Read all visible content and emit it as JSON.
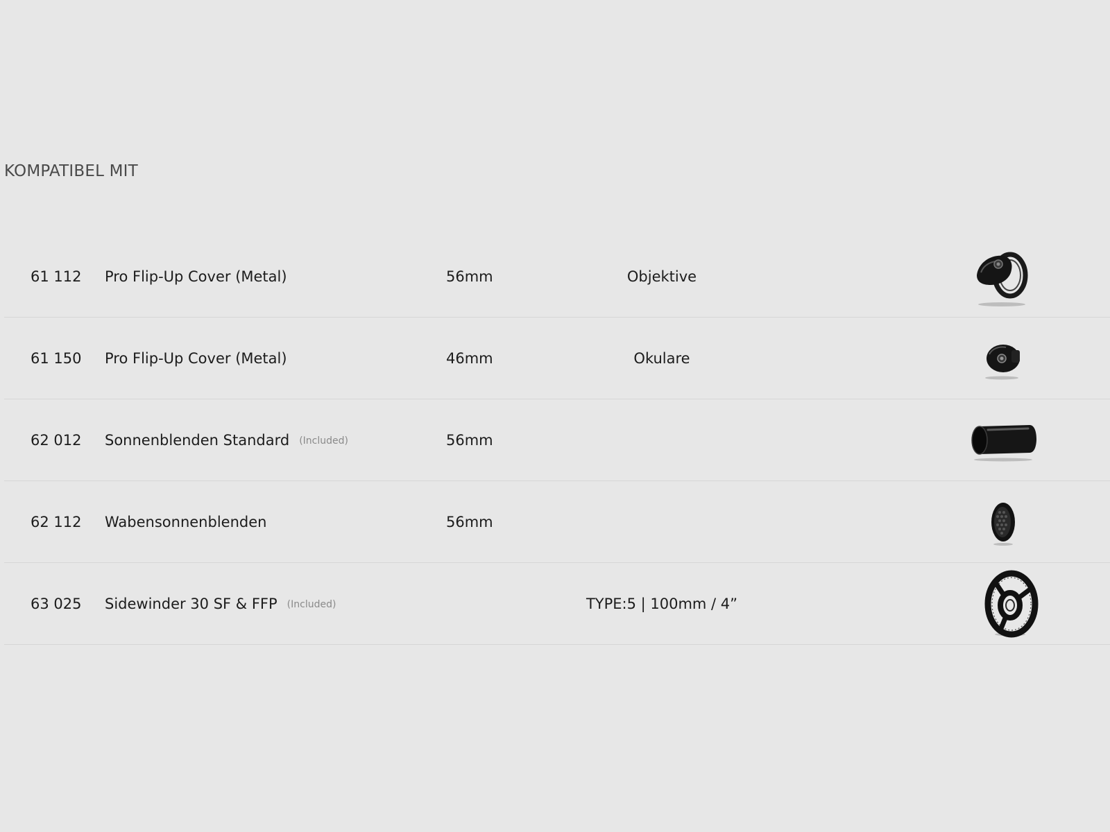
{
  "page": {
    "title": "KOMPATIBEL MIT"
  },
  "rows": [
    {
      "article": "61 112",
      "name": "Pro Flip-Up Cover (Metal)",
      "included": "",
      "size": "56mm",
      "type": "Objektive",
      "icon": "flip-up-cover-large-icon"
    },
    {
      "article": "61 150",
      "name": "Pro Flip-Up Cover (Metal)",
      "included": "",
      "size": "46mm",
      "type": "Okulare",
      "icon": "flip-up-cover-small-icon"
    },
    {
      "article": "62 012",
      "name": "Sonnenblenden Standard",
      "included": "(Included)",
      "size": "56mm",
      "type": "",
      "icon": "sunshade-tube-icon"
    },
    {
      "article": "62 112",
      "name": "Wabensonnenblenden",
      "included": "",
      "size": "56mm",
      "type": "",
      "icon": "honeycomb-filter-icon"
    },
    {
      "article": "63 025",
      "name": "Sidewinder 30 SF & FFP",
      "included": "(Included)",
      "size": "",
      "type": "TYPE:5 | 100mm / 4”",
      "icon": "sidewinder-wheel-icon"
    }
  ]
}
